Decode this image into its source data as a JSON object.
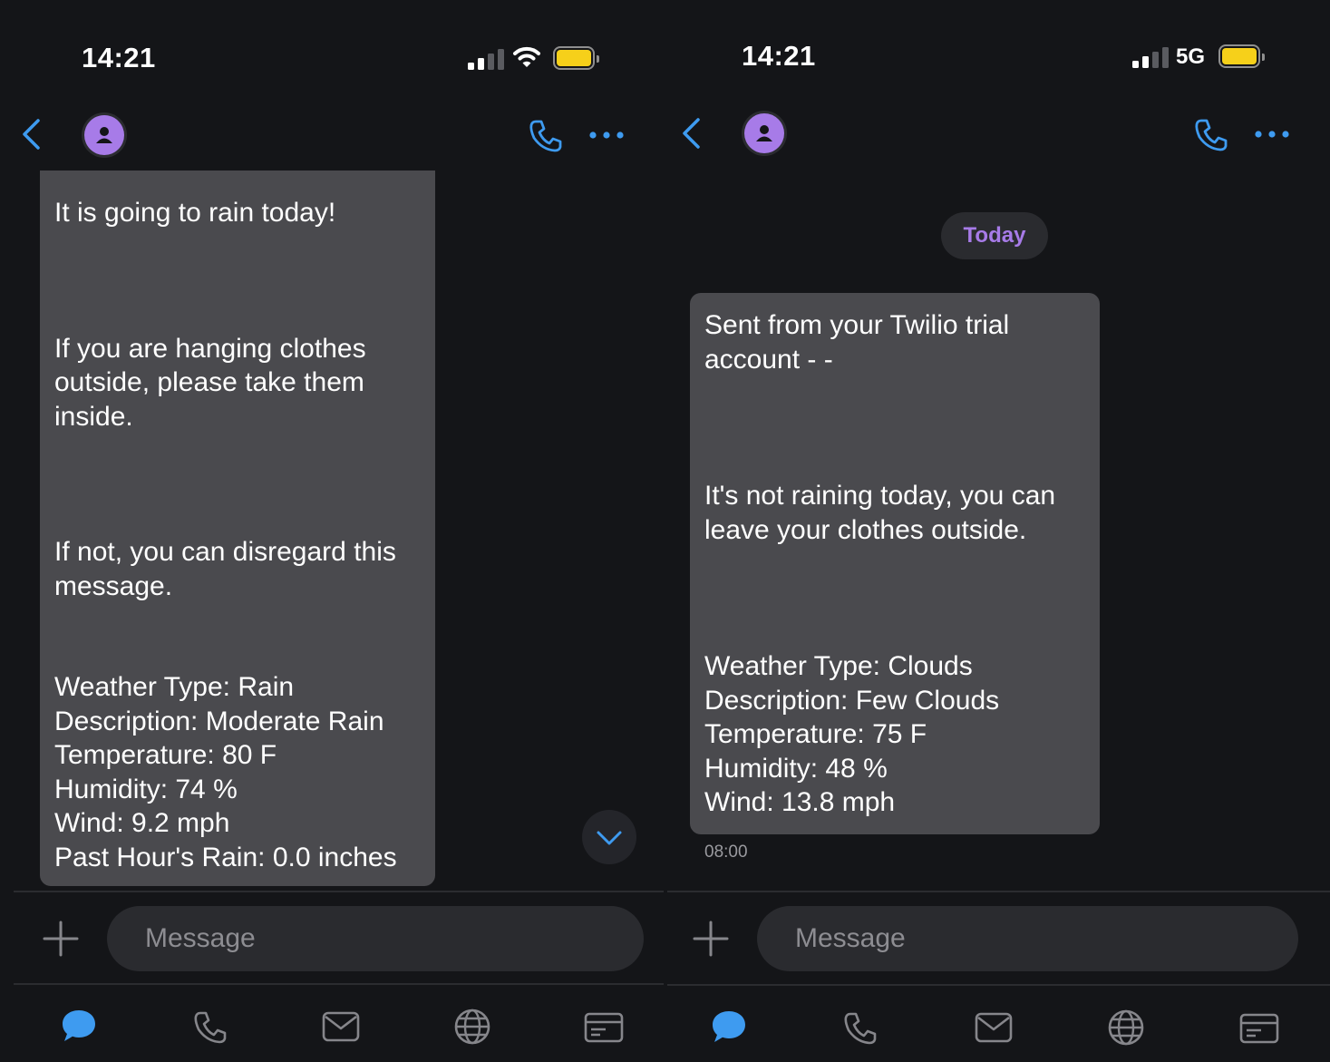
{
  "left": {
    "status": {
      "time": "14:21"
    },
    "message": {
      "paragraphs": [
        "It is going to rain today!",
        "If you are hanging clothes\noutside, please take them\ninside.",
        "If not, you can disregard this\nmessage.",
        "Weather Type: Rain\nDescription: Moderate Rain\nTemperature: 80 F\nHumidity: 74 %\nWind: 9.2 mph\nPast Hour's Rain: 0.0 inches"
      ]
    },
    "composer": {
      "placeholder": "Message"
    }
  },
  "right": {
    "status": {
      "time": "14:21",
      "network": "5G"
    },
    "date_separator": "Today",
    "message": {
      "paragraphs": [
        "Sent from your Twilio trial\naccount - -",
        "It's not raining today, you can\nleave your clothes outside.",
        "Weather Type: Clouds\nDescription: Few Clouds\nTemperature: 75 F\nHumidity: 48 %\nWind: 13.8 mph"
      ],
      "timestamp": "08:00"
    },
    "composer": {
      "placeholder": "Message"
    }
  },
  "tabbar": {
    "items": [
      "messages-icon",
      "phone-icon",
      "mail-icon",
      "globe-icon",
      "card-icon"
    ],
    "active": "messages-icon"
  },
  "colors": {
    "accent_blue": "#3e9bf0",
    "avatar_purple": "#a77be8",
    "bubble": "#4a4a4e",
    "background": "#141518",
    "battery": "#f6d01a"
  }
}
